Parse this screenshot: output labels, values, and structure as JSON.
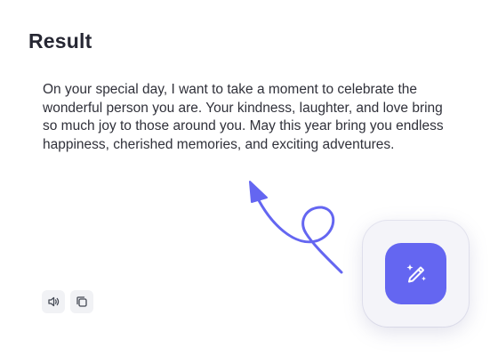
{
  "result": {
    "title": "Result",
    "text": "On your special day, I want to take a moment to celebrate the wonderful person you are. Your kindness, laughter, and love bring so much joy to those around you. May this year bring you endless happiness, cherished memories, and exciting adventures."
  },
  "actions": {
    "speaker_icon": "speaker-icon",
    "copy_icon": "copy-icon"
  },
  "fab": {
    "icon": "magic-wand-icon",
    "color": "#6466f1"
  },
  "annotation": {
    "arrow_color": "#6466f1"
  }
}
